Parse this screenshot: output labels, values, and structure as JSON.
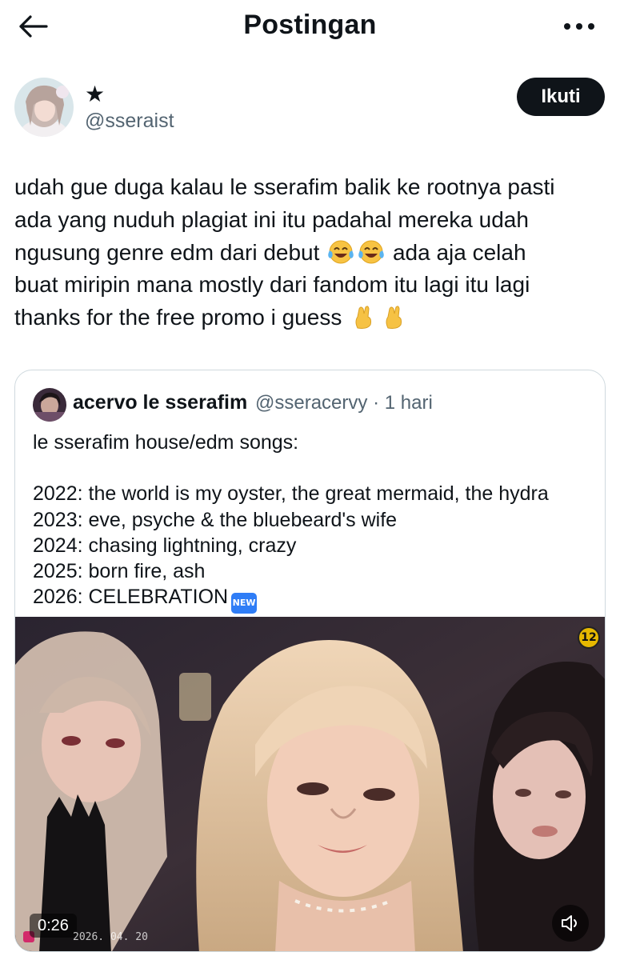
{
  "header": {
    "title": "Postingan",
    "back_icon": "arrow-left-icon",
    "more_icon": "more-horizontal-icon"
  },
  "author": {
    "name": "★",
    "handle": "@sseraist",
    "follow_label": "Ikuti"
  },
  "post": {
    "lines": [
      "udah gue duga kalau le sserafim balik ke rootnya pasti",
      "ada yang nuduh plagiat ini itu padahal mereka udah",
      "ngusung genre edm dari debut",
      "ada aja celah",
      "buat miripin mana mostly dari fandom itu lagi itu lagi",
      "thanks for the free promo i guess"
    ],
    "emoji": [
      "face-with-tears-of-joy",
      "pinched-fingers"
    ]
  },
  "quote": {
    "name": "acervo le sserafim",
    "handle": "@sseracervy",
    "separator": "·",
    "time": "1 hari",
    "lines": [
      "le sserafim house/edm songs:",
      "",
      "2022: the world is my oyster, the great mermaid, the hydra",
      "2023: eve, psyche & the bluebeard's wife",
      "2024: chasing lightning, crazy",
      "2025: born fire, ash",
      "2026: CELEBRATION"
    ],
    "new_badge": "NEW",
    "video": {
      "duration": "0:26",
      "date_stamp": "2026. 04. 20",
      "rating": "12",
      "volume_icon": "volume-muted-icon"
    }
  },
  "colors": {
    "text": "#0f1419",
    "secondary": "#536471",
    "border": "#cfd9de",
    "follow_bg": "#0f1419"
  }
}
